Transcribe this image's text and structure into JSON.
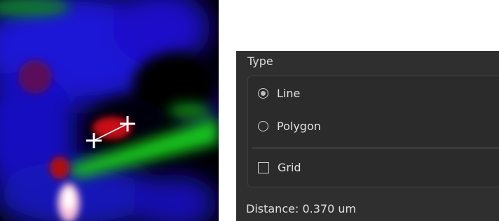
{
  "image_view": {
    "measurement_tool": "line"
  },
  "panel": {
    "type_label": "Type",
    "options": [
      {
        "label": "Line",
        "selected": true
      },
      {
        "label": "Polygon",
        "selected": false
      }
    ],
    "grid": {
      "label": "Grid",
      "checked": false
    },
    "distance_text": "Distance: 0.370 um"
  },
  "colors": {
    "panel_bg": "#2f2f2f",
    "text": "#e6e6e6",
    "accent_line": "#ffffff"
  }
}
